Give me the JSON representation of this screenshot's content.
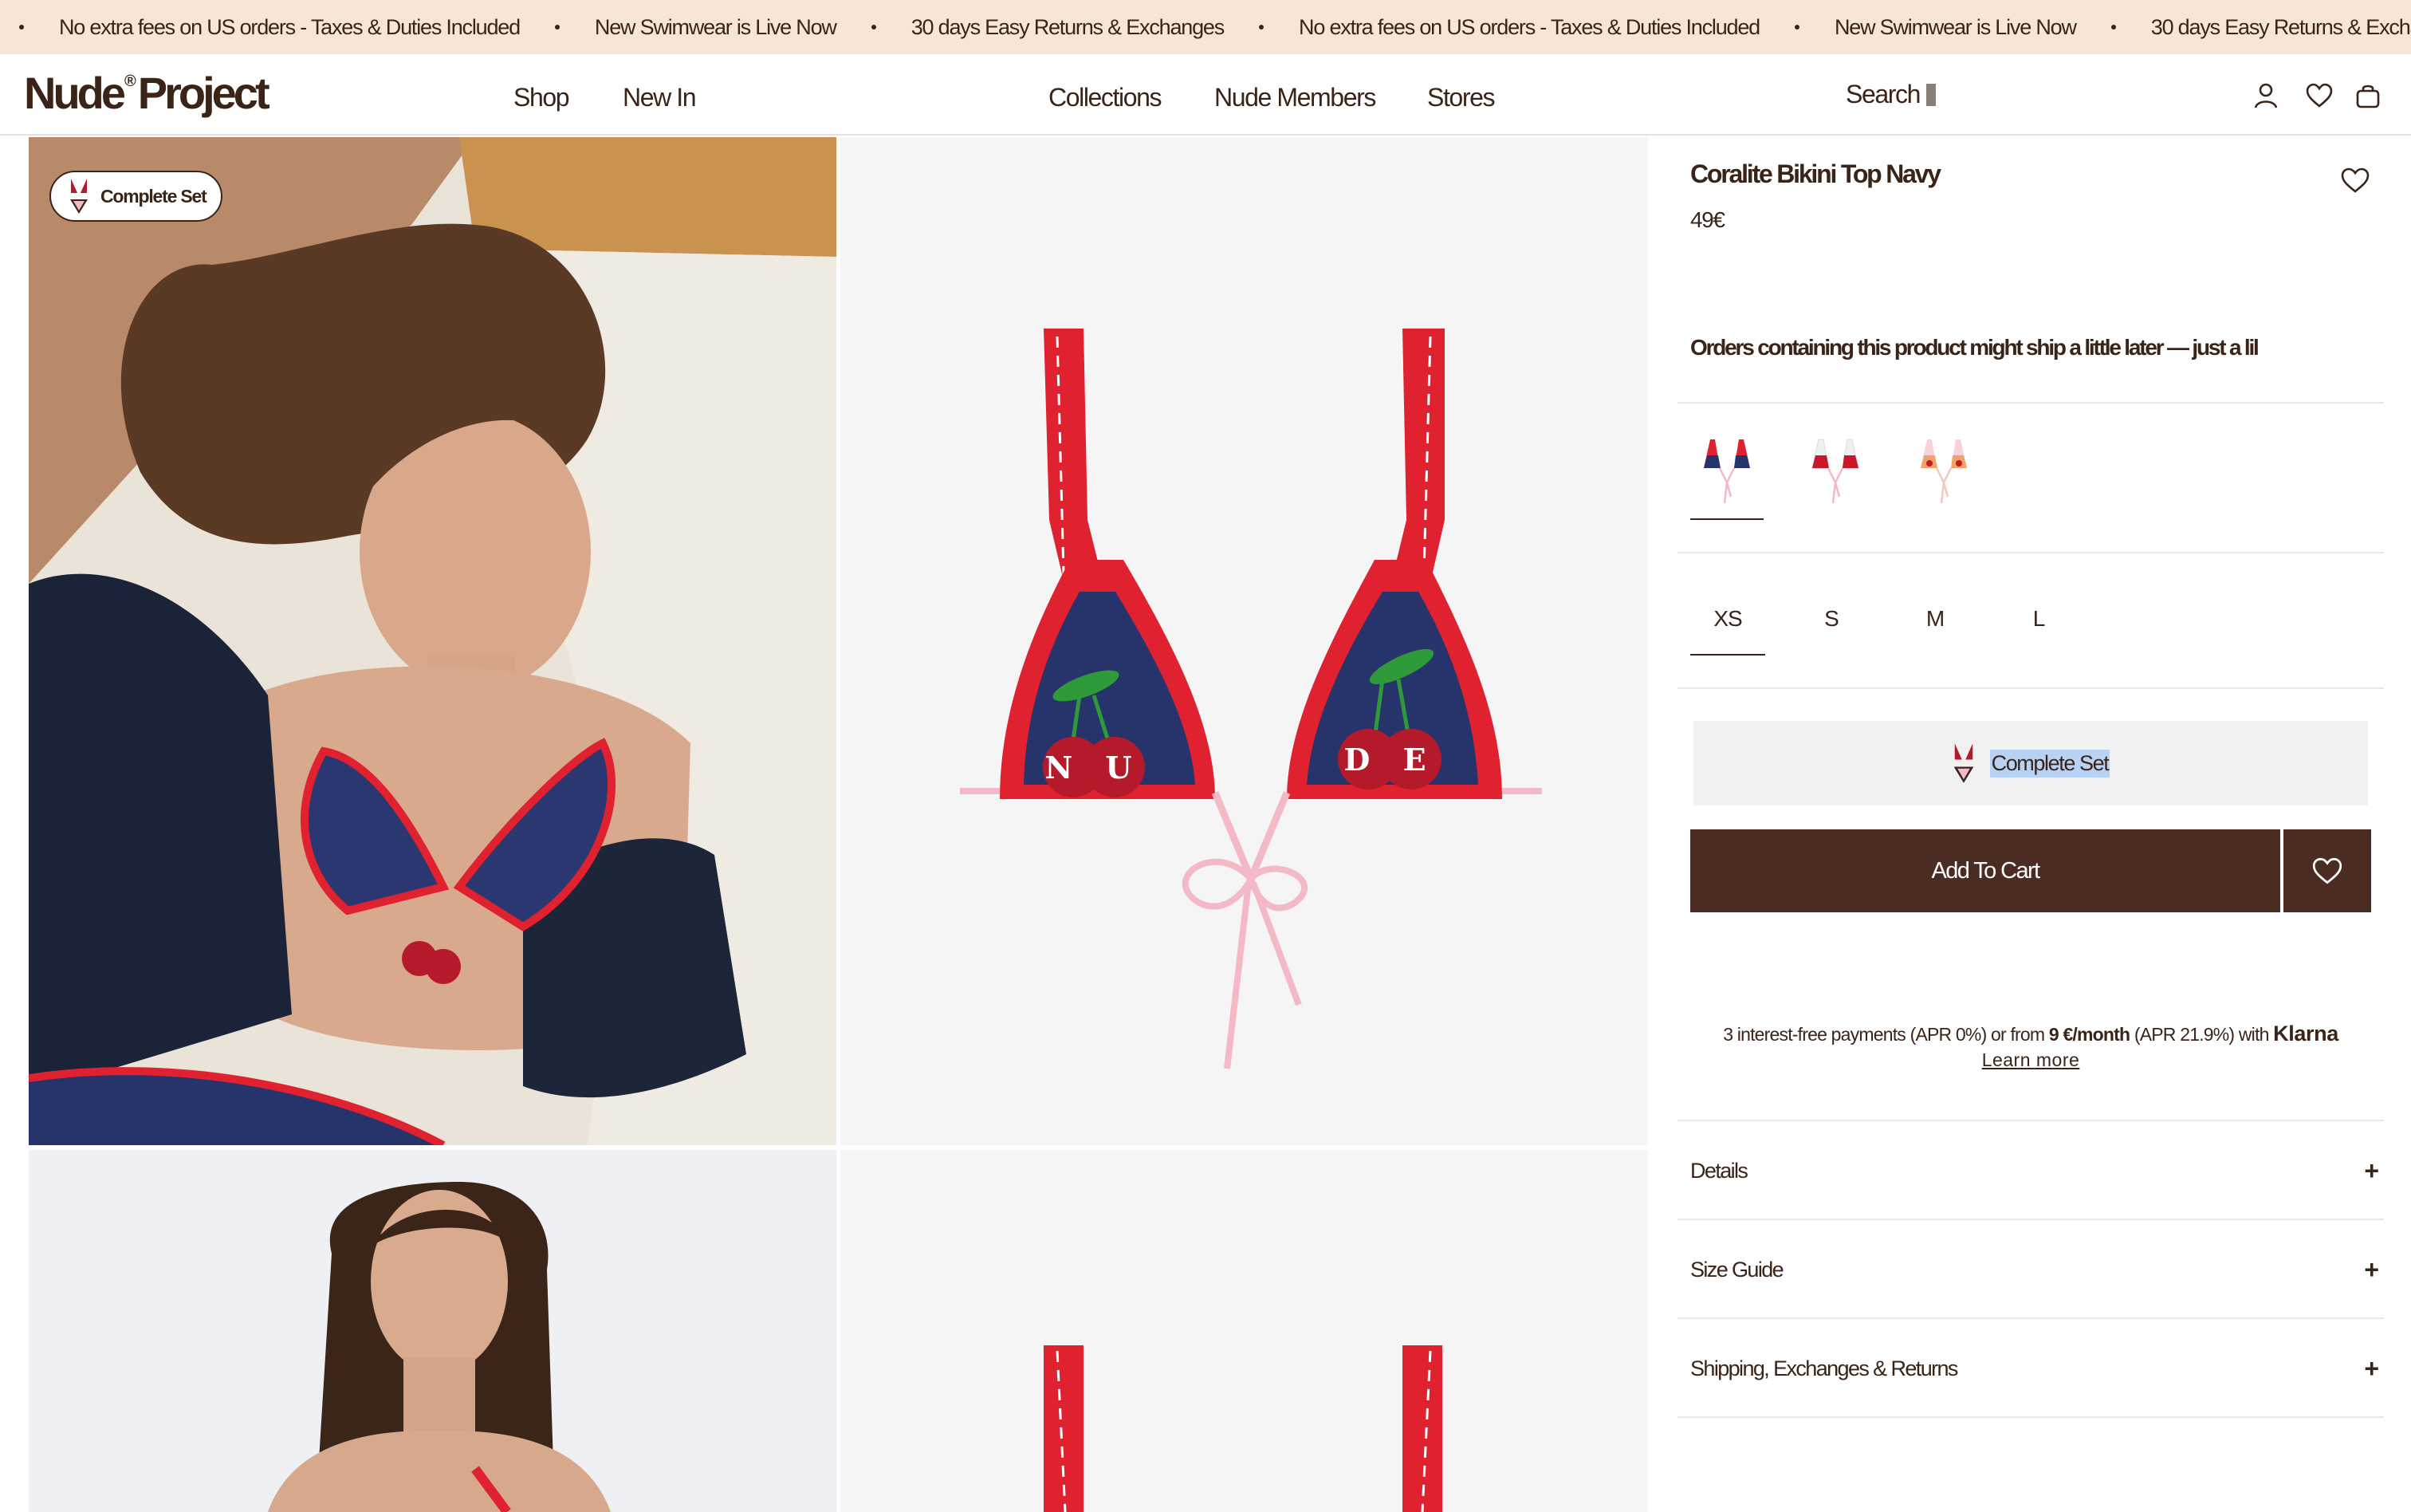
{
  "announcement": {
    "messages": [
      "No extra fees on US orders - Taxes & Duties Included",
      "New Swimwear is Live Now",
      "30 days Easy Returns & Exchanges",
      "No extra fees on US orders - Taxes & Duties Included",
      "New Swimwear is Live Now",
      "30 days Easy Returns & Exchanges"
    ]
  },
  "header": {
    "logo_left": "Nude",
    "logo_mark": "®",
    "logo_right": "Project",
    "nav": {
      "shop": "Shop",
      "new_in": "New In",
      "collections": "Collections",
      "nude_members": "Nude Members",
      "stores": "Stores"
    },
    "search_label": "Search",
    "icons": [
      "user-icon",
      "heart-icon",
      "bag-icon"
    ]
  },
  "gallery": {
    "badge_label": "Complete Set",
    "letters_left": "N U",
    "letters_right": "D E"
  },
  "product": {
    "title": "Coralite Bikini Top Navy",
    "price": "49€",
    "shipping_note": "Orders containing this product might ship a little later — just a lil",
    "colors": [
      "navy",
      "red",
      "pink"
    ],
    "sizes": [
      "XS",
      "S",
      "M",
      "L"
    ],
    "selected_size": "XS",
    "complete_set_label": "Complete Set",
    "add_to_cart_label": "Add To Cart",
    "klarna": {
      "text_before": "3 interest-free payments (APR 0%) or from ",
      "amount": "9 €/month",
      "text_after": " (APR 21.9%) with ",
      "brand": "Klarna",
      "learn_more": "Learn more"
    },
    "accordions": {
      "details": "Details",
      "size_guide": "Size Guide",
      "shipping": "Shipping, Exchanges & Returns"
    },
    "accordion_icon": "+"
  },
  "colors": {
    "brand_brown": "#4a2c22",
    "text": "#3a2418",
    "announcement_bg": "#f7e6d8",
    "bikini_red": "#e0212f",
    "bikini_navy": "#27346b",
    "tie_pink": "#f4b9c6"
  }
}
